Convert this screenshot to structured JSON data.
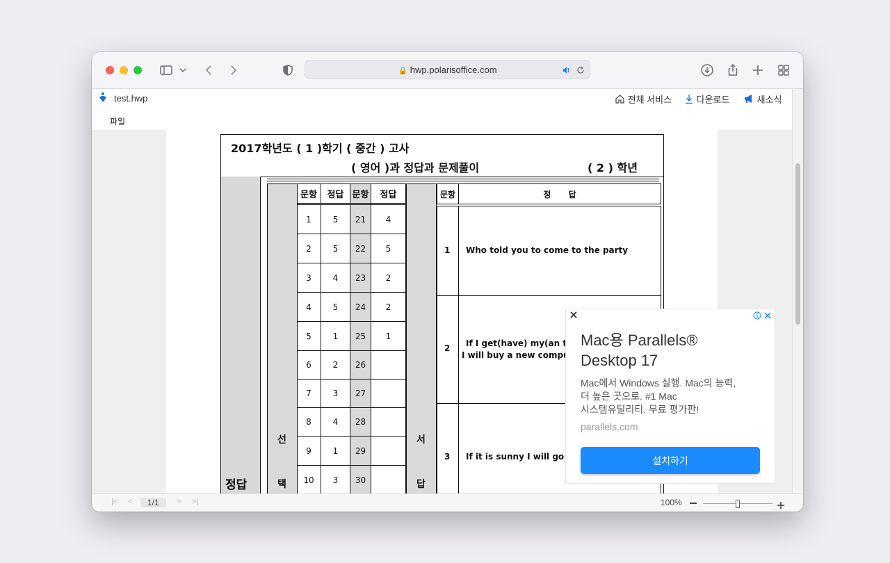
{
  "browser": {
    "url": "hwp.polarisoffice.com"
  },
  "app": {
    "filename": "test.hwp",
    "links": [
      "전체 서비스",
      "다운로드",
      "새소식"
    ],
    "menu": [
      "파일"
    ]
  },
  "exam": {
    "title_line1": "2017학년도  ( 1 )학기  ( 중간 ) 고사",
    "title_subject": "(   영어   )과   정답과 문제풀이",
    "title_grade": "( 2 ) 학년",
    "side_label": "정답",
    "selection_labels": [
      "선",
      "택"
    ],
    "essay_labels": [
      "서",
      "답"
    ],
    "mc_headers": [
      "문항",
      "정답",
      "문항",
      "정답"
    ],
    "mc_rows": [
      [
        "1",
        "5",
        "21",
        "4"
      ],
      [
        "2",
        "5",
        "22",
        "5"
      ],
      [
        "3",
        "4",
        "23",
        "2"
      ],
      [
        "4",
        "5",
        "24",
        "2"
      ],
      [
        "5",
        "1",
        "25",
        "1"
      ],
      [
        "6",
        "2",
        "26",
        ""
      ],
      [
        "7",
        "3",
        "27",
        ""
      ],
      [
        "8",
        "4",
        "28",
        ""
      ],
      [
        "9",
        "1",
        "29",
        ""
      ],
      [
        "10",
        "3",
        "30",
        ""
      ]
    ],
    "essay_headers": [
      "문항",
      "정      답"
    ],
    "essay_rows": [
      {
        "num": "1",
        "lines": [
          "Who told you to come to the party"
        ]
      },
      {
        "num": "2",
        "lines": [
          "If I get(have) my(an the)",
          "I will buy a new computer"
        ]
      },
      {
        "num": "3",
        "lines": [
          "If it is sunny I will go to t"
        ]
      }
    ]
  },
  "status": {
    "page": "1/1",
    "zoom": "100%"
  },
  "ad": {
    "title_line1": "Mac용 Parallels®",
    "title_line2": "Desktop 17",
    "body_lines": [
      "Mac에서 Windows 실행. Mac의 능력,",
      "더 높은 곳으로. #1 Mac",
      "시스템유틸리티. 무료 평가판!"
    ],
    "domain": "parallels.com",
    "button": "설치하기"
  },
  "colors": {
    "accent": "#1a8cff",
    "traffic_red": "#fe5f57",
    "traffic_yellow": "#febc2e",
    "traffic_green": "#28c840"
  }
}
